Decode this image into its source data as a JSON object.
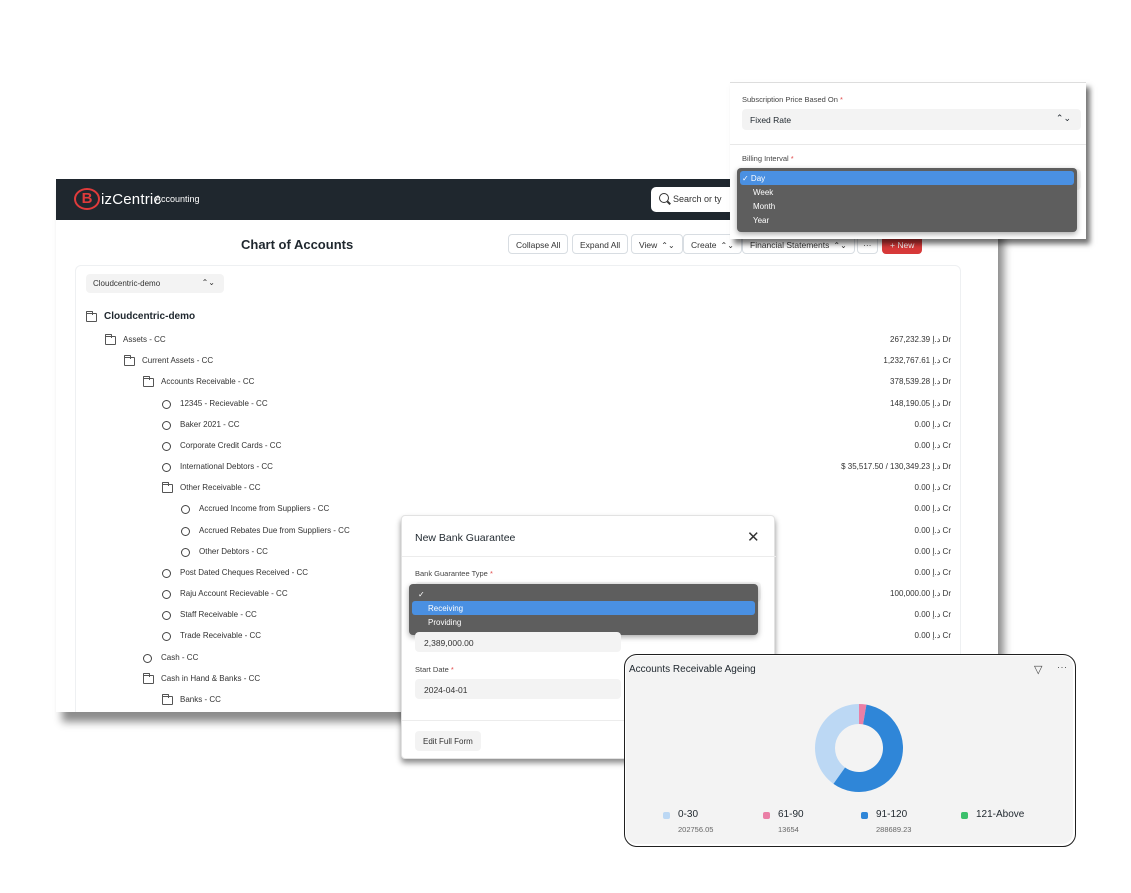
{
  "navbar": {
    "brand_letter": "B",
    "brand_name": "izCentric",
    "module": "Accounting",
    "search_placeholder": "Search or ty"
  },
  "page": {
    "title": "Chart of Accounts"
  },
  "toolbar": {
    "collapse_all": "Collapse All",
    "expand_all": "Expand All",
    "view": "View",
    "create": "Create",
    "financial_statements": "Financial Statements",
    "more": "···",
    "new": "New"
  },
  "company_filter": {
    "value": "Cloudcentric-demo"
  },
  "tree": [
    {
      "label": "Cloudcentric-demo",
      "type": "root",
      "balance": ""
    },
    {
      "label": "Assets - CC",
      "type": "group",
      "balance": "267,232.39 د.إ Dr"
    },
    {
      "label": "Current Assets - CC",
      "type": "group",
      "balance": "1,232,767.61 د.إ Cr"
    },
    {
      "label": "Accounts Receivable - CC",
      "type": "group",
      "balance": "378,539.28 د.إ Dr"
    },
    {
      "label": "12345 - Recievable - CC",
      "type": "leaf",
      "balance": "148,190.05 د.إ Dr"
    },
    {
      "label": "Baker 2021 - CC",
      "type": "leaf",
      "balance": "0.00 د.إ Cr"
    },
    {
      "label": "Corporate Credit Cards - CC",
      "type": "leaf",
      "balance": "0.00 د.إ Cr"
    },
    {
      "label": "International Debtors - CC",
      "type": "leaf",
      "balance": "$ 35,517.50 / 130,349.23 د.إ Dr"
    },
    {
      "label": "Other Receivable - CC",
      "type": "group",
      "balance": "0.00 د.إ Cr"
    },
    {
      "label": "Accrued Income from Suppliers - CC",
      "type": "leaf",
      "balance": "0.00 د.إ Cr"
    },
    {
      "label": "Accrued Rebates Due from Suppliers - CC",
      "type": "leaf",
      "balance": "0.00 د.إ Cr"
    },
    {
      "label": "Other Debtors - CC",
      "type": "leaf",
      "balance": "0.00 د.إ Cr"
    },
    {
      "label": "Post Dated Cheques Received - CC",
      "type": "leaf",
      "balance": "0.00 د.إ Cr"
    },
    {
      "label": "Raju Account Recievable - CC",
      "type": "leaf",
      "balance": "100,000.00 د.إ Dr"
    },
    {
      "label": "Staff Receivable - CC",
      "type": "leaf",
      "balance": "0.00 د.إ Cr"
    },
    {
      "label": "Trade Receivable - CC",
      "type": "leaf",
      "balance": "0.00 د.إ Cr"
    },
    {
      "label": "Cash - CC",
      "type": "leaf",
      "balance": ""
    },
    {
      "label": "Cash in Hand & Banks - CC",
      "type": "group",
      "balance": ""
    },
    {
      "label": "Banks - CC",
      "type": "group",
      "balance": ""
    }
  ],
  "subscription": {
    "price_label": "Subscription Price Based On",
    "price_value": "Fixed Rate",
    "billing_label": "Billing Interval",
    "required_mark": "*",
    "billing_options": [
      {
        "label": "✓ Day",
        "selected": true
      },
      {
        "label": "Week",
        "selected": false
      },
      {
        "label": "Month",
        "selected": false
      },
      {
        "label": "Year",
        "selected": false
      }
    ]
  },
  "bank_guarantee": {
    "title": "New Bank Guarantee",
    "close": "✕",
    "type_label": "Bank Guarantee Type",
    "required_mark": "*",
    "type_options": [
      {
        "label": "✓",
        "selected": false,
        "check": true
      },
      {
        "label": "Receiving",
        "selected": true
      },
      {
        "label": "Providing",
        "selected": false
      }
    ],
    "amount_value": "2,389,000.00",
    "start_date_label": "Start Date",
    "start_date_value": "2024-04-01",
    "edit_full_form": "Edit Full Form"
  },
  "ageing": {
    "title": "Accounts Receivable Ageing",
    "filter_icon": "filter-icon",
    "more": "···"
  },
  "chart_data": {
    "type": "pie",
    "title": "Accounts Receivable Ageing",
    "categories": [
      "0-30",
      "61-90",
      "91-120",
      "121-Above"
    ],
    "values": [
      202756.05,
      13654,
      288689.23,
      0
    ],
    "value_labels": [
      "202756.05",
      "13654",
      "288689.23",
      ""
    ],
    "colors": [
      "#bcd8f4",
      "#ea7fa6",
      "#2f86d8",
      "#3cc06c"
    ],
    "donut": true,
    "legend": "bottom"
  }
}
